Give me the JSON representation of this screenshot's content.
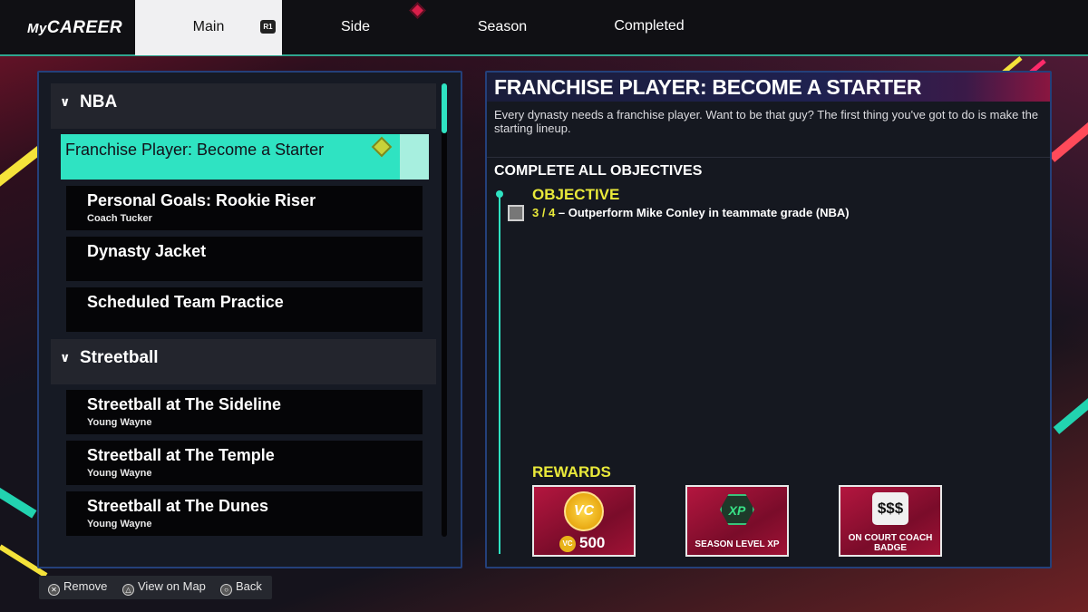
{
  "app": {
    "logo": "CAREER",
    "logo_prefix": "My"
  },
  "tabs": [
    {
      "label": "Main",
      "badge": "R1",
      "active": true
    },
    {
      "label": "Side"
    },
    {
      "label": "Season"
    },
    {
      "label": "Completed"
    }
  ],
  "quest_list": {
    "groups": [
      {
        "label": "NBA",
        "items": [
          {
            "title": "Franchise Player: Become a Starter",
            "subtitle": "",
            "selected": true
          },
          {
            "title": "Personal Goals: Rookie Riser",
            "subtitle": "Coach Tucker"
          },
          {
            "title": "Dynasty Jacket",
            "subtitle": ""
          },
          {
            "title": "Scheduled Team Practice",
            "subtitle": ""
          }
        ]
      },
      {
        "label": "Streetball",
        "items": [
          {
            "title": "Streetball at The Sideline",
            "subtitle": "Young Wayne"
          },
          {
            "title": "Streetball at The Temple",
            "subtitle": "Young Wayne"
          },
          {
            "title": "Streetball at The Dunes",
            "subtitle": "Young Wayne"
          }
        ]
      }
    ]
  },
  "detail": {
    "title": "FRANCHISE PLAYER: BECOME A STARTER",
    "description": "Every dynasty needs a franchise player. Want to be that guy? The first thing you've got to do is make the starting lineup.",
    "complete_heading": "COMPLETE ALL OBJECTIVES",
    "objective_heading": "OBJECTIVE",
    "objective": {
      "progress": "3 / 4",
      "text": " – Outperform Mike Conley in teammate grade (NBA)"
    },
    "rewards_heading": "REWARDS",
    "rewards": [
      {
        "type": "vc",
        "icon_text": "VC",
        "small_icon_text": "VC",
        "amount": "500"
      },
      {
        "type": "xp",
        "icon_text": "XP",
        "label": "SEASON LEVEL XP"
      },
      {
        "type": "badge",
        "icon_text": "$$$",
        "label": "ON COURT COACH BADGE"
      }
    ]
  },
  "help": [
    {
      "glyph": "✕",
      "label": "Remove"
    },
    {
      "glyph": "△",
      "label": "View on Map"
    },
    {
      "glyph": "○",
      "label": "Back"
    }
  ],
  "colors": {
    "accent_teal": "#2fe3c2",
    "objective_yellow": "#e9e93a",
    "panel_border": "#24407a",
    "reward_red": "#b4163f"
  }
}
